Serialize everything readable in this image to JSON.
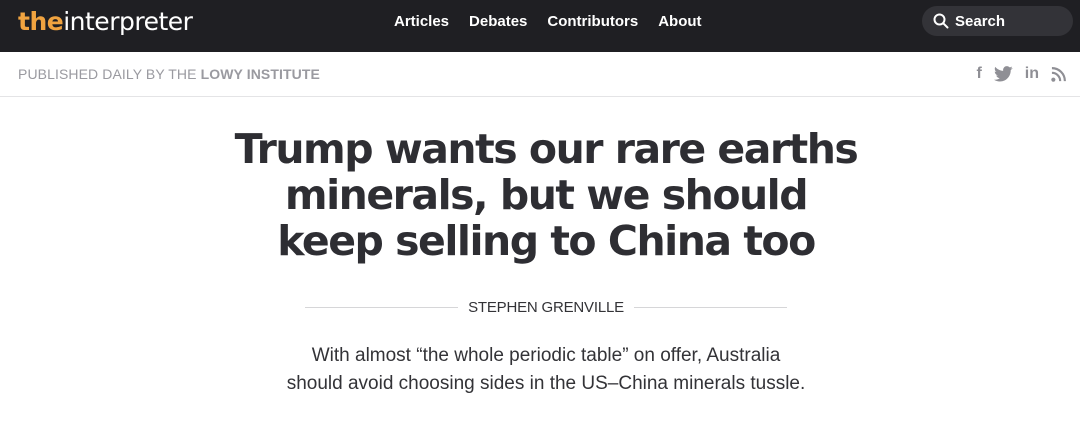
{
  "header": {
    "logo_prefix": "the",
    "logo_name": "interpreter",
    "nav": [
      "Articles",
      "Debates",
      "Contributors",
      "About"
    ],
    "search_label": "Search"
  },
  "subheader": {
    "tagline_prefix": "PUBLISHED DAILY BY THE",
    "tagline_institute": "LOWY INSTITUTE",
    "social_icons": [
      "facebook-icon",
      "twitter-icon",
      "linkedin-icon",
      "rss-icon"
    ],
    "social_labels": [
      "f",
      "in"
    ]
  },
  "article": {
    "headline_lines": [
      "Trump wants our rare earths",
      "minerals, but we should",
      "keep selling to China too"
    ],
    "author": "STEPHEN GRENVILLE",
    "standfirst_lines": [
      "With almost “the whole periodic table” on offer, Australia",
      "should avoid choosing sides in the US–China minerals tussle."
    ]
  },
  "colors": {
    "topbar_bg": "#1f1f23",
    "logo_accent": "#f0a340",
    "text_dark": "#2e2e33",
    "muted": "#9a9aa0"
  }
}
